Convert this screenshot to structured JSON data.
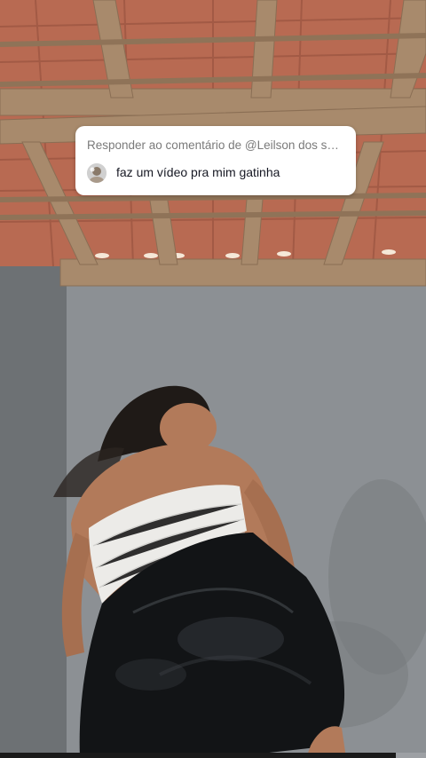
{
  "reply_card": {
    "header": "Responder ao comentário de @Leilson dos s…",
    "comment": "faz um vídeo pra mim gatinha",
    "avatar_icon": "user-avatar-icon"
  },
  "video": {
    "progress_fraction": 0.93
  },
  "colors": {
    "roof_tile": "#b86a52",
    "beam": "#a88a6c",
    "wall": "#8e9296",
    "top_white": "#ecebe8",
    "shorts_black": "#121416"
  }
}
